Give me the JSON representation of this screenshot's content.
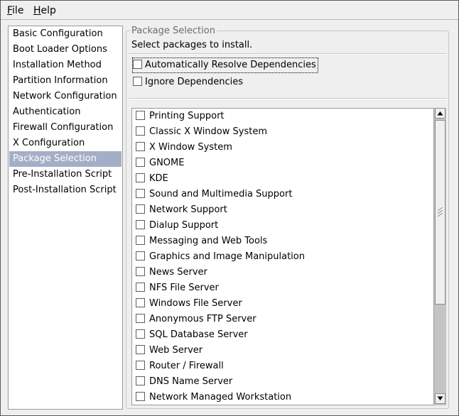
{
  "menubar": {
    "file": {
      "mnemonic": "F",
      "rest": "ile"
    },
    "help": {
      "mnemonic": "H",
      "rest": "elp"
    }
  },
  "sidebar": {
    "items": [
      {
        "label": "Basic Configuration"
      },
      {
        "label": "Boot Loader Options"
      },
      {
        "label": "Installation Method"
      },
      {
        "label": "Partition Information"
      },
      {
        "label": "Network Configuration"
      },
      {
        "label": "Authentication"
      },
      {
        "label": "Firewall Configuration"
      },
      {
        "label": "X Configuration"
      },
      {
        "label": "Package Selection",
        "selected": true
      },
      {
        "label": "Pre-Installation Script"
      },
      {
        "label": "Post-Installation Script"
      }
    ]
  },
  "panel": {
    "legend": "Package Selection",
    "intro": "Select packages to install.",
    "auto_resolve": {
      "label": "Automatically Resolve Dependencies",
      "checked": false
    },
    "ignore_deps": {
      "label": "Ignore Dependencies",
      "checked": false
    }
  },
  "packages": [
    {
      "label": "Printing Support",
      "checked": false
    },
    {
      "label": "Classic X Window System",
      "checked": false
    },
    {
      "label": "X Window System",
      "checked": false
    },
    {
      "label": "GNOME",
      "checked": false
    },
    {
      "label": "KDE",
      "checked": false
    },
    {
      "label": "Sound and Multimedia Support",
      "checked": false
    },
    {
      "label": "Network Support",
      "checked": false
    },
    {
      "label": "Dialup Support",
      "checked": false
    },
    {
      "label": "Messaging and Web Tools",
      "checked": false
    },
    {
      "label": "Graphics and Image Manipulation",
      "checked": false
    },
    {
      "label": "News Server",
      "checked": false
    },
    {
      "label": "NFS File Server",
      "checked": false
    },
    {
      "label": "Windows File Server",
      "checked": false
    },
    {
      "label": "Anonymous FTP Server",
      "checked": false
    },
    {
      "label": "SQL Database Server",
      "checked": false
    },
    {
      "label": "Web Server",
      "checked": false
    },
    {
      "label": "Router / Firewall",
      "checked": false
    },
    {
      "label": "DNS Name Server",
      "checked": false
    },
    {
      "label": "Network Managed Workstation",
      "checked": false
    }
  ],
  "scrollbar": {
    "position": 0.0,
    "visible_fraction": 0.65
  },
  "colors": {
    "selection": "#a5aec7",
    "window_bg": "#efefef",
    "trough": "#c4c4c4"
  },
  "icons": {
    "scroll_up": "arrow-up-icon",
    "scroll_down": "arrow-down-icon"
  }
}
